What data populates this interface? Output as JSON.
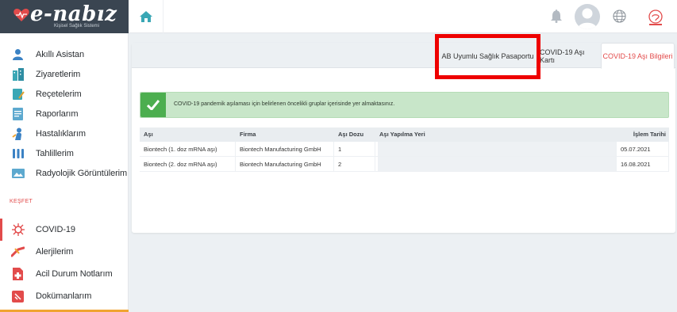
{
  "app": {
    "logo_text": "e-nabız",
    "logo_sub": "Kişisel Sağlık Sistemi"
  },
  "sidebar": {
    "items": [
      {
        "label": "Akıllı Asistan",
        "icon": "assistant-icon",
        "color": "#3b82c4"
      },
      {
        "label": "Ziyaretlerim",
        "icon": "building-icon",
        "color": "#3aa7b5"
      },
      {
        "label": "Reçetelerim",
        "icon": "prescription-icon",
        "color": "#3aa7b5"
      },
      {
        "label": "Raporlarım",
        "icon": "report-icon",
        "color": "#3aa7b5"
      },
      {
        "label": "Hastalıklarım",
        "icon": "patient-icon",
        "color": "#3b82c4"
      },
      {
        "label": "Tahlillerim",
        "icon": "test-tubes-icon",
        "color": "#3b82c4"
      },
      {
        "label": "Radyolojik Görüntülerim",
        "icon": "radiology-icon",
        "color": "#3aa7b5"
      }
    ],
    "section_label": "KEŞFET",
    "explore_items": [
      {
        "label": "COVID-19",
        "icon": "virus-icon",
        "color": "#e24b4b"
      },
      {
        "label": "Alerjilerim",
        "icon": "allergy-icon",
        "color": "#e24b4b"
      },
      {
        "label": "Acil Durum Notlarım",
        "icon": "emergency-note-icon",
        "color": "#e24b4b"
      },
      {
        "label": "Dokümanlarım",
        "icon": "documents-icon",
        "color": "#e24b4b"
      }
    ]
  },
  "tabs": {
    "tab1": "AB Uyumlu Sağlık Pasaportu",
    "tab2": "COVID-19 Aşı Kartı",
    "tab3": "COVID-19 Aşı Bilgileri"
  },
  "alert": {
    "text": "COVID-19 pandemik aşılaması için belirlenen öncelikli gruplar içerisinde yer almaktasınız."
  },
  "table": {
    "headers": [
      "Aşı",
      "Firma",
      "Aşı Dozu",
      "Aşı Yapılma Yeri",
      "İşlem Tarihi"
    ],
    "rows": [
      [
        "Biontech (1. doz mRNA aşı)",
        "Biontech Manufacturing GmbH",
        "1",
        "",
        "05.07.2021"
      ],
      [
        "Biontech (2. doz mRNA aşı)",
        "Biontech Manufacturing GmbH",
        "2",
        "",
        "16.08.2021"
      ]
    ]
  },
  "colors": {
    "accent": "#e24b4b",
    "success": "#4cae4f",
    "success_bg": "#c8e6c9",
    "logo_bg": "#3a4551",
    "highlight": "#ee0000"
  }
}
